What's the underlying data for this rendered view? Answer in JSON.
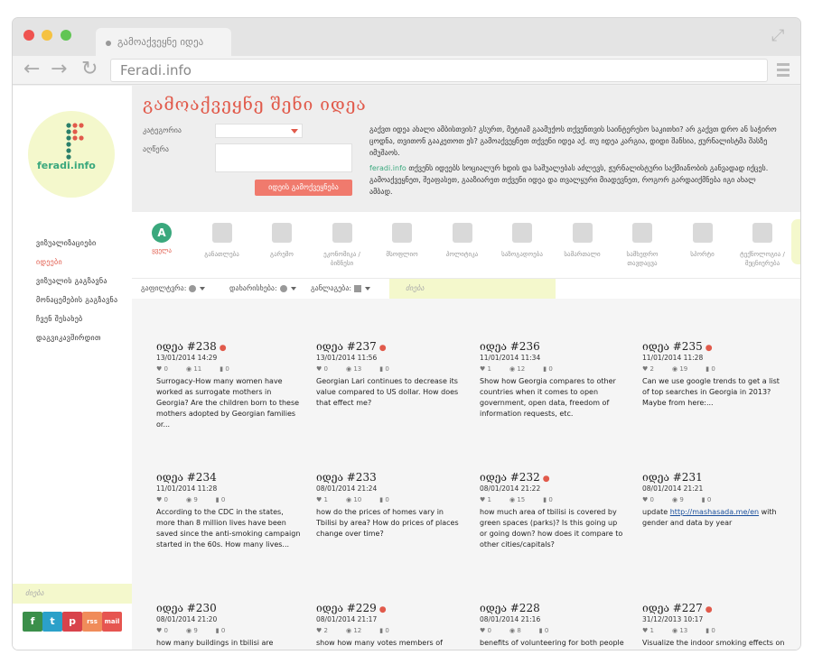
{
  "browser": {
    "tab_title": "გამოაქვეყნე იდეა",
    "url": "Feradi.info"
  },
  "sidebar": {
    "logo_text": "feradi.info",
    "menu": [
      "ვიზუალიზაციები",
      "იდეები",
      "ვიზუალის გაგზავნა",
      "მონაცემების გაგზავნა",
      "ჩვენ შესახებ",
      "დაგვიკავშირდით"
    ],
    "search_placeholder": "ძიება",
    "social": [
      "f",
      "t",
      "p",
      "rss",
      "mail"
    ],
    "social_colors": [
      "#3b8f4a",
      "#2ba0c9",
      "#d8434b",
      "#f08c5a",
      "#e65550"
    ]
  },
  "form": {
    "title": "გამოაქვეყნე შენი იდეა",
    "category_label": "კატეგორია",
    "description_label": "აღწერა",
    "submit_label": "იდეის გამოქვეყნება"
  },
  "intro": {
    "p1": "გაქვთ იდეა ახალი ამბისთვის? გსურთ, მეტიამ გაამუქოს თქვენთვის საინტერესო საკითხი? არ გაქვთ დრო ან საჭირო ცოდნა, თვითონ გააკეთოთ ეს? გამოაქვეყნეთ თქვენი იდეა აქ. თუ იდეა კარგია, დიდი შანსია, ჟურნალისტმა შასზე იმუშაოს.",
    "brand": "feradi.info",
    "p2": "თქვენს იდეებს სოციალურ ხდის და საშუალებას აძლევს, ჟურნალისტური საქმიანობის განვადად იქცეს. გამოაქვეყნეთ, შეაფასეთ, გააზიარეთ თქვენი იდეა და თვალყური მიადევნეთ, როგორ გარდაიქმნება იგი ახალ ამბად."
  },
  "categories": [
    {
      "label": "ყველა",
      "icon": "all-icon",
      "glyph": "A",
      "active": true
    },
    {
      "label": "განათლება",
      "icon": "education-icon"
    },
    {
      "label": "გარემო",
      "icon": "environment-icon"
    },
    {
      "label": "ეკონომიკა / ბიზნესი",
      "icon": "economy-icon"
    },
    {
      "label": "მსოფლიო",
      "icon": "world-icon"
    },
    {
      "label": "პოლიტიკა",
      "icon": "politics-icon"
    },
    {
      "label": "საზოგადოება",
      "icon": "society-icon"
    },
    {
      "label": "სამართალი",
      "icon": "law-icon"
    },
    {
      "label": "სამხედრო თავდაცვა",
      "icon": "military-icon"
    },
    {
      "label": "სპორტი",
      "icon": "sport-icon"
    },
    {
      "label": "ტექნოლოგია / მეცნიერება",
      "icon": "tech-icon"
    }
  ],
  "filters": {
    "filter_label": "გაფილტვრა:",
    "sort_label": "დახარისხება:",
    "layout_label": "განლაგება:",
    "search_placeholder": "ძიება"
  },
  "ideas": [
    {
      "title": "იდეა #238",
      "pin": true,
      "date": "13/01/2014 14:29",
      "likes": "0",
      "views": "11",
      "comments": "0",
      "text": "Surrogacy-How many women have worked as surrogate mothers in Georgia? Are the children born to these mothers adopted by Georgian families or..."
    },
    {
      "title": "იდეა #237",
      "pin": true,
      "date": "13/01/2014 11:56",
      "likes": "0",
      "views": "13",
      "comments": "0",
      "text": "Georgian Lari continues to decrease its value compared to US dollar. How does that effect me?"
    },
    {
      "title": "იდეა #236",
      "pin": false,
      "date": "11/01/2014 11:34",
      "likes": "1",
      "views": "12",
      "comments": "0",
      "text": "Show how Georgia compares to other countries when it comes to open government, open data, freedom of information requests, etc."
    },
    {
      "title": "იდეა #235",
      "pin": true,
      "date": "11/01/2014 11:28",
      "likes": "2",
      "views": "19",
      "comments": "0",
      "text": "Can we use google trends to get a list of top searches in Georgia in 2013? Maybe from here:..."
    },
    {
      "title": "იდეა #234",
      "pin": false,
      "date": "11/01/2014 11:28",
      "likes": "0",
      "views": "9",
      "comments": "0",
      "text": "According to the CDC in the states, more than 8 million lives have been saved since the anti-smoking campaign started in the 60s. How many lives..."
    },
    {
      "title": "იდეა #233",
      "pin": false,
      "date": "08/01/2014 21:24",
      "likes": "1",
      "views": "10",
      "comments": "0",
      "text": "how do the prices of homes vary in Tbilisi by area? How do prices of places change over time?"
    },
    {
      "title": "იდეა #232",
      "pin": true,
      "date": "08/01/2014 21:22",
      "likes": "1",
      "views": "15",
      "comments": "0",
      "text": "how much area of tbilisi is covered by green spaces (parks)? Is this going up or going down? how does it compare to other cities/capitals?"
    },
    {
      "title": "იდეა #231",
      "pin": false,
      "date": "08/01/2014 21:21",
      "likes": "0",
      "views": "9",
      "comments": "0",
      "text_prefix": "update ",
      "link": "http://mashasada.me/en",
      "text_suffix": " with gender and data by year"
    },
    {
      "title": "იდეა #230",
      "pin": false,
      "date": "08/01/2014 21:20",
      "likes": "0",
      "views": "9",
      "comments": "0",
      "text": "how many buildings in tbilisi are abandoned or are finished but still in"
    },
    {
      "title": "იდეა #229",
      "pin": true,
      "date": "08/01/2014 21:17",
      "likes": "2",
      "views": "12",
      "comments": "0",
      "text": "show how many votes members of parliament have made since starting"
    },
    {
      "title": "იდეა #228",
      "pin": false,
      "date": "08/01/2014 21:16",
      "likes": "0",
      "views": "8",
      "comments": "0",
      "text": "benefits of volunteering for both people and organizations"
    },
    {
      "title": "იდეა #227",
      "pin": true,
      "date": "31/12/2013 10:17",
      "likes": "1",
      "views": "13",
      "comments": "0",
      "text": "Visualize the indoor smoking effects on non-smokers"
    }
  ],
  "colors": {
    "accent_red": "#e15a4b",
    "brand_green": "#3aa87d",
    "highlight_yellow": "#f4f8cc"
  }
}
